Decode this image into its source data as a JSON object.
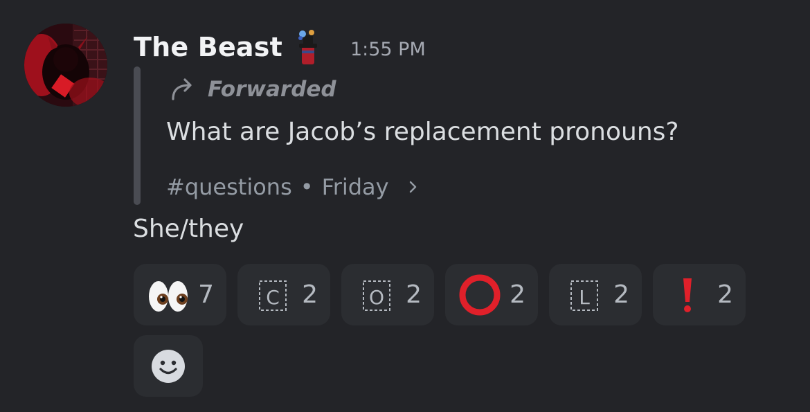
{
  "message": {
    "username": "The Beast",
    "timestamp": "1:55 PM",
    "content": "She/they",
    "role_icon": "top-hat-avatar-icon",
    "forwarded": {
      "label": "Forwarded",
      "text": "What are Jacob’s replacement pronouns?",
      "channel": "#questions",
      "separator": "•",
      "date": "Friday"
    }
  },
  "reactions": [
    {
      "emoji": "eyes",
      "count": "7"
    },
    {
      "emoji": "regional-c",
      "letter": "C",
      "count": "2"
    },
    {
      "emoji": "regional-o",
      "letter": "O",
      "count": "2"
    },
    {
      "emoji": "red-circle-o",
      "count": "2"
    },
    {
      "emoji": "regional-l",
      "letter": "L",
      "count": "2"
    },
    {
      "emoji": "exclamation",
      "count": "2"
    }
  ],
  "colors": {
    "background": "#232428",
    "reaction_bg": "#2b2d31",
    "red": "#e0202a"
  }
}
